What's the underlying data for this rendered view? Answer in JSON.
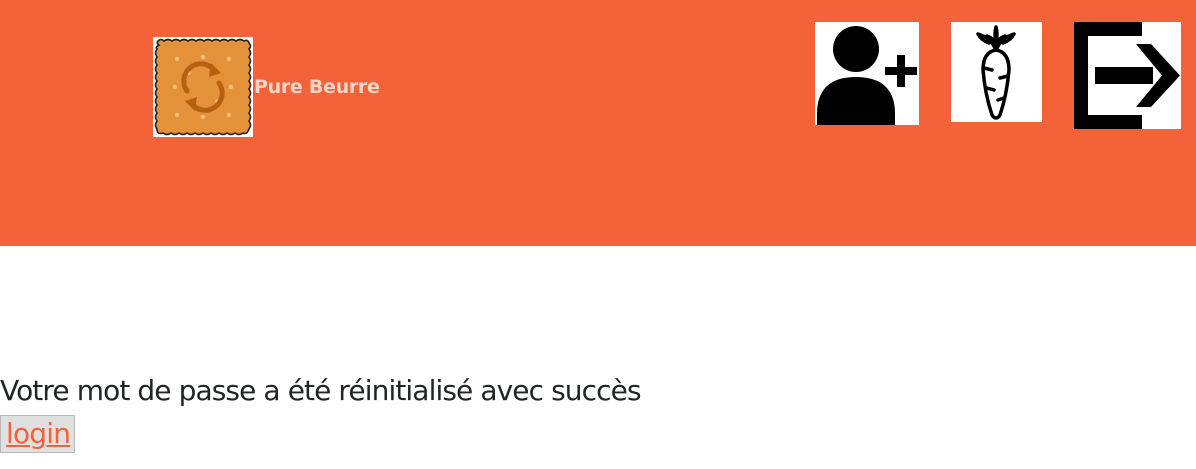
{
  "header": {
    "brand_name": "Pure Beurre",
    "background_color": "#f4623a",
    "logo_icon": "biscuit-refresh-icon",
    "nav_icons": [
      "add-user-icon",
      "carrot-icon",
      "logout-icon"
    ]
  },
  "main": {
    "message": "Votre mot de passe a été réinitialisé avec succès",
    "login_label": "login"
  }
}
